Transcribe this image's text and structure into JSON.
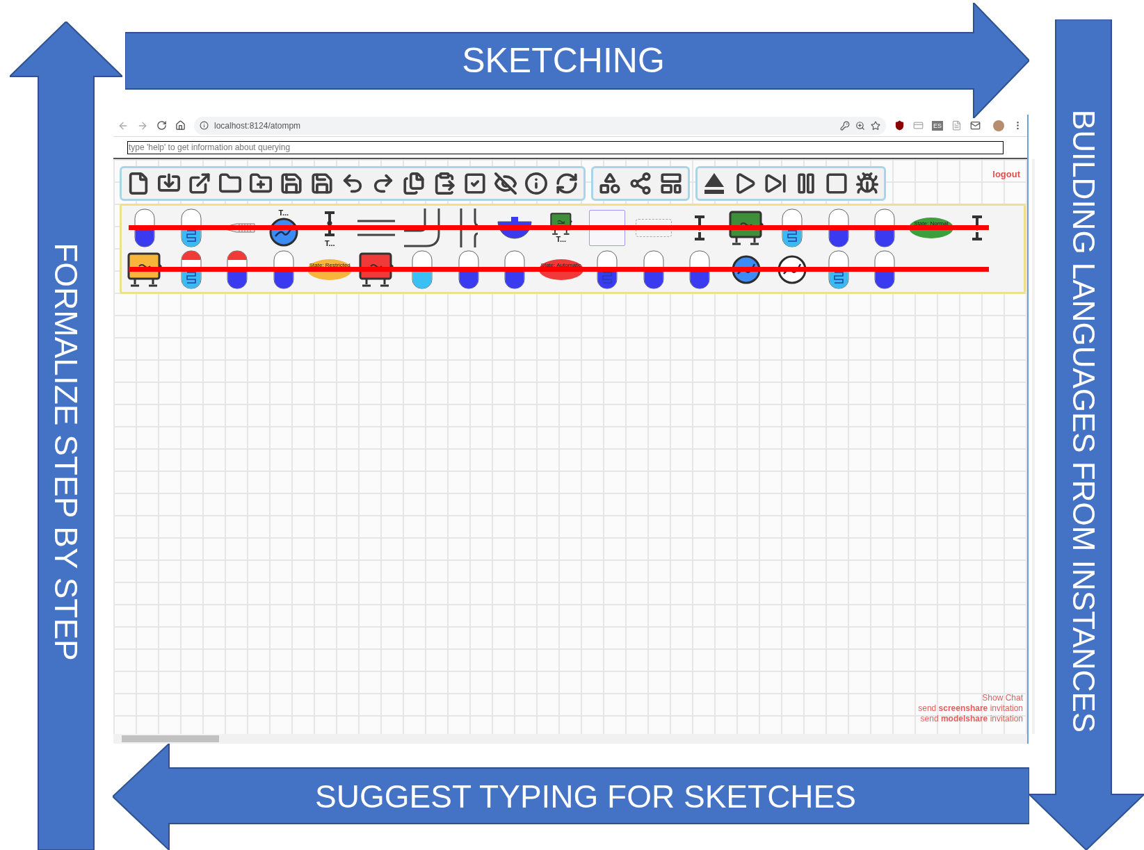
{
  "arrows": [
    {
      "kind": "right",
      "label": "SKETCHING"
    },
    {
      "kind": "down",
      "label": "BUILDING LANGUAGES FROM INSTANCES"
    },
    {
      "kind": "left",
      "label": "SUGGEST TYPING FOR SKETCHES"
    },
    {
      "kind": "up",
      "label": "FORMALIZE STEP BY STEP"
    }
  ],
  "browser": {
    "url": "localhost:8124/atompm",
    "extension_badge": "ES"
  },
  "query_field": {
    "placeholder": "type 'help' to get information about querying"
  },
  "logout": "logout",
  "palette": {
    "rows": [
      {
        "crossed_out": true,
        "items": [
          {
            "kind": "tank",
            "color": "#3a3af0"
          },
          {
            "kind": "coil-tank",
            "color": "#3bb9f0"
          },
          {
            "kind": "nozzle"
          },
          {
            "kind": "pump",
            "color": "#3d8bf5",
            "label": "T..."
          },
          {
            "kind": "valve",
            "label": "T..."
          },
          {
            "kind": "pipe"
          },
          {
            "kind": "pipe-bend"
          },
          {
            "kind": "pipe-split"
          },
          {
            "kind": "bowl",
            "color": "#3a3af0"
          },
          {
            "kind": "machine",
            "color": "#3f8f3a",
            "label": "T..."
          },
          {
            "kind": "frame"
          },
          {
            "kind": "dashed-frame"
          },
          {
            "kind": "valve"
          },
          {
            "kind": "machine",
            "color": "#3f8f3a"
          },
          {
            "kind": "coil-tank",
            "color": "#3bb9f0"
          },
          {
            "kind": "tank",
            "color": "#3a3af0"
          },
          {
            "kind": "tank",
            "color": "#3a3af0"
          },
          {
            "kind": "state",
            "color": "#3e9e3e",
            "label": "State: Normal"
          },
          {
            "kind": "valve"
          }
        ]
      },
      {
        "crossed_out": true,
        "items": [
          {
            "kind": "machine",
            "color": "#f7b53b"
          },
          {
            "kind": "capped-coil-tank",
            "color": "#3bb9f0"
          },
          {
            "kind": "capped-tank",
            "color": "#3a3af0"
          },
          {
            "kind": "tank",
            "color": "#3a3af0"
          },
          {
            "kind": "state",
            "color": "#f7b53b",
            "label": "State: Restricted"
          },
          {
            "kind": "machine",
            "color": "#f03a3a"
          },
          {
            "kind": "tank",
            "color": "#3bc0f5"
          },
          {
            "kind": "tank",
            "color": "#3a3af0"
          },
          {
            "kind": "tank",
            "color": "#3a3af0"
          },
          {
            "kind": "state",
            "color": "#f03a3a",
            "label": "State: Automatic"
          },
          {
            "kind": "coil-tank",
            "color": "#3a3af0"
          },
          {
            "kind": "tank",
            "color": "#3a3af0"
          },
          {
            "kind": "tank",
            "color": "#3a3af0"
          },
          {
            "kind": "pump",
            "color": "#3d8bf5"
          },
          {
            "kind": "pump",
            "color": "#ffffff"
          },
          {
            "kind": "coil-tank",
            "color": "#3bb9f0"
          },
          {
            "kind": "tank",
            "color": "#3a3af0"
          }
        ]
      }
    ]
  },
  "footer_links": [
    "Show Chat",
    "send **screenshare** invitation",
    "send **modelshare** invitation"
  ]
}
